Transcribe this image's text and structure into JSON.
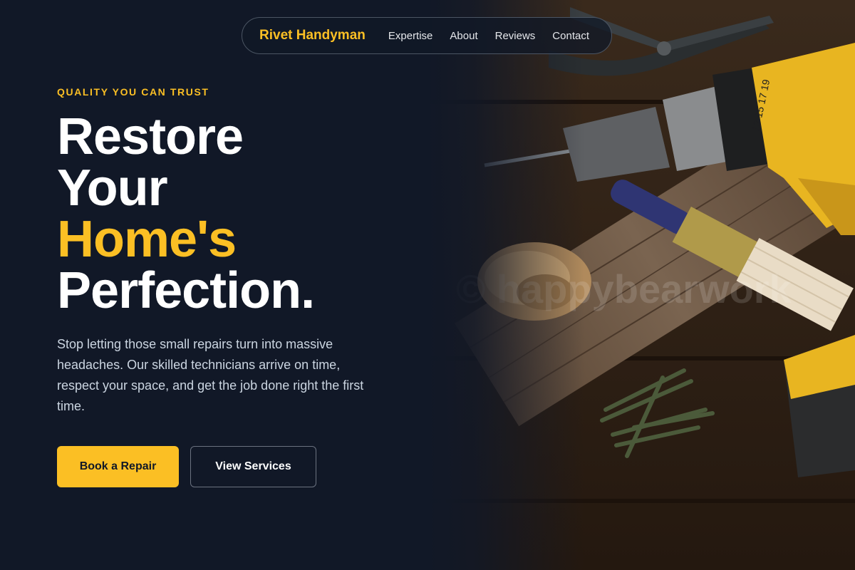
{
  "nav": {
    "brand": "Rivet Handyman",
    "links": [
      "Expertise",
      "About",
      "Reviews",
      "Contact"
    ]
  },
  "hero": {
    "eyebrow": "QUALITY YOU CAN TRUST",
    "headline_lines": [
      "Restore",
      "Your",
      "Home's",
      "Perfection."
    ],
    "headline_accent_line": "Home's",
    "description": "Stop letting those small repairs turn into massive headaches. Our skilled technicians arrive on time, respect your space, and get the job done right the first time.",
    "primary_button": "Book a Repair",
    "secondary_button": "View Services",
    "image_watermark": "© happybearwork"
  },
  "colors": {
    "background": "#111827",
    "accent": "#fbbf24",
    "text": "#ffffff",
    "muted_text": "#cbd5e1"
  }
}
